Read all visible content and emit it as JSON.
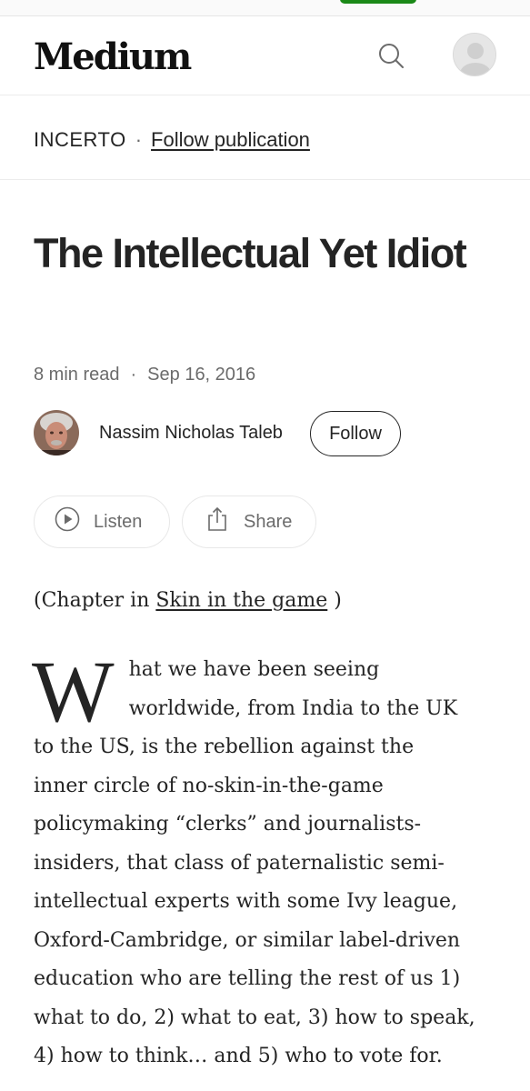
{
  "header": {
    "logo": "Medium",
    "search_icon": "search-icon",
    "avatar_icon": "user-avatar-icon"
  },
  "publication": {
    "name": "INCERTO",
    "separator": "·",
    "follow_label": "Follow publication"
  },
  "article": {
    "title": "The Intellectual Yet Idiot",
    "read_time": "8 min read",
    "meta_separator": "·",
    "date": "Sep 16, 2016",
    "author": "Nassim Nicholas Taleb",
    "follow_label": "Follow",
    "listen_label": "Listen",
    "share_label": "Share",
    "chapter_prefix": "(Chapter in ",
    "chapter_link": "Skin in the game",
    "chapter_suffix": " )",
    "dropcap": "W",
    "body_lines": [
      "hat we have been seeing",
      "worldwide, from India to the UK",
      "to the US, is the rebellion against the",
      "inner circle of no-skin-in-the-game",
      "policymaking “clerks” and journalists-",
      "insiders, that class of paternalistic semi-",
      "intellectual experts with some Ivy league,",
      "Oxford-Cambridge, or similar label-driven",
      "education who are telling the rest of us 1)",
      "what to do, 2) what to eat, 3) how to speak,",
      "4) how to think… and 5) who to vote for."
    ]
  },
  "colors": {
    "accent_green": "#1a8917",
    "text": "#242424",
    "muted": "#6b6b6b"
  }
}
